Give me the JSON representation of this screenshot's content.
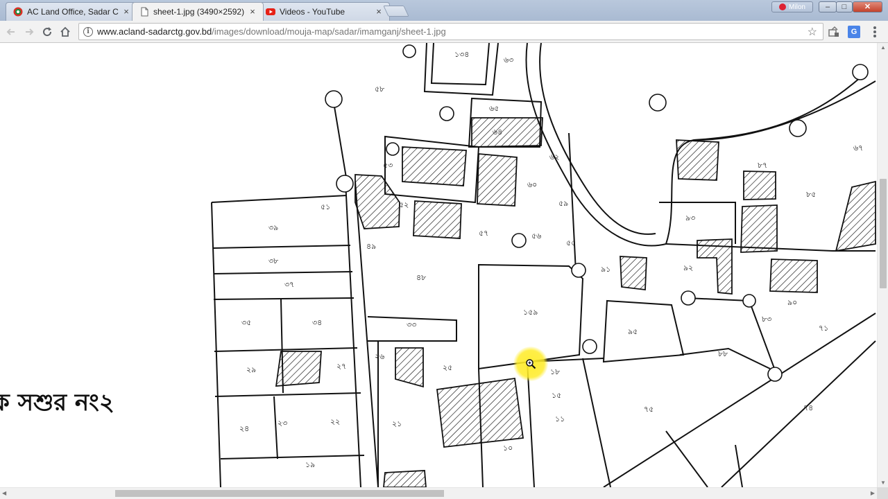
{
  "browser": {
    "tabs": [
      {
        "title": "AC Land Office, Sadar Ct",
        "favicon": "chrome-site-icon",
        "active": false
      },
      {
        "title": "sheet-1.jpg (3490×2592)",
        "favicon": "document-icon",
        "active": true
      },
      {
        "title": "Videos - YouTube",
        "favicon": "youtube-icon",
        "active": false
      }
    ],
    "tab_close_glyph": "×",
    "profile_name": "Milon",
    "window_controls": {
      "minimize": "–",
      "maximize": "□",
      "close": "✕"
    },
    "url_host": "www.acland-sadarctg.gov.bd",
    "url_path": "/images/download/mouja-map/sadar/imamganj/sheet-1.jpg",
    "translate_glyph": "G"
  },
  "map": {
    "sheet_title": "ক সশুর নং২",
    "plot_numbers": [
      "১৫৯",
      "১৩৪",
      "৬৩",
      "৫৮",
      "৬৫",
      "৬৪",
      "৬২",
      "৬০",
      "৫৯",
      "৫৭",
      "৫৬",
      "৫৫",
      "৫৩",
      "৫২",
      "৫১",
      "৪৯",
      "৪৮",
      "৩৯",
      "৩৮",
      "৩৭",
      "৩৫",
      "৩৪",
      "৩৩",
      "২৯",
      "২৭",
      "২৬",
      "২৫",
      "২৪",
      "২৩",
      "২২",
      "২১",
      "১৯",
      "১৮",
      "১৫",
      "১১",
      "১০",
      "৯৫",
      "৯৩",
      "৯২",
      "৯১",
      "৯০",
      "৮৮",
      "৮৭",
      "৮৫",
      "৮৩",
      "৭৫",
      "৭৪",
      "৭১",
      "৬৭"
    ],
    "cursor": "zoom-in"
  },
  "scroll": {
    "vertical_fraction": 0.3,
    "horizontal_fraction": 0.13
  }
}
